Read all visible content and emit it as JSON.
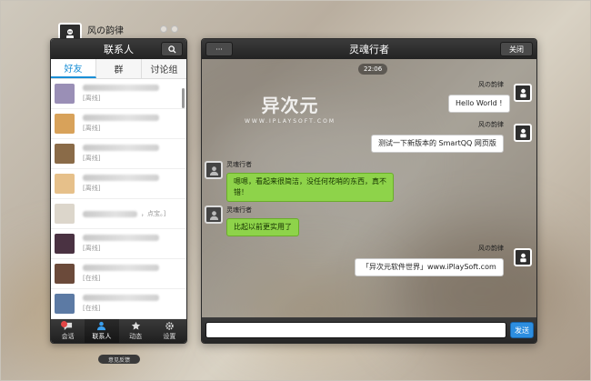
{
  "user": {
    "name": "风の韵律"
  },
  "contacts": {
    "title": "联系人",
    "tabs": [
      "好友",
      "群",
      "讨论组"
    ],
    "items": [
      {
        "status": "[离线]",
        "color": "#9a8fb6"
      },
      {
        "status": "[离线]",
        "color": "#d8a25a"
      },
      {
        "status": "[离线]",
        "color": "#8a6b48"
      },
      {
        "status": "[离线]",
        "color": "#e6c08a"
      },
      {
        "status": "",
        "color": "#dcd6cb"
      },
      {
        "status": "[离线]",
        "color": "#4a3242"
      },
      {
        "status": "[在线]",
        "color": "#6b4a3a"
      },
      {
        "status": "[在线]",
        "color": "#5c7aa4"
      }
    ],
    "item_note": "，点宝。]"
  },
  "nav": {
    "items": [
      {
        "label": "会话",
        "icon": "chat-bubble-icon"
      },
      {
        "label": "联系人",
        "icon": "person-icon"
      },
      {
        "label": "动态",
        "icon": "star-icon"
      },
      {
        "label": "设置",
        "icon": "gear-icon"
      }
    ]
  },
  "feedback_label": "意见反馈",
  "chat": {
    "title": "灵魂行者",
    "more_label": "···",
    "close_label": "关闭",
    "time": "22:06",
    "watermark": {
      "main": "异次元",
      "sub": "WWW.IPLAYSOFT.COM"
    },
    "send_label": "发送",
    "messages": [
      {
        "side": "out",
        "sender": "风の韵律",
        "text": "Hello World !"
      },
      {
        "side": "out",
        "sender": "风の韵律",
        "text": "测试一下新版本的 SmartQQ 网页版"
      },
      {
        "side": "in",
        "sender": "灵魂行者",
        "line1": "嗯嗯，看起来很简洁，没任何花哨的东西，真不",
        "line2": "错！"
      },
      {
        "side": "in",
        "sender": "灵魂行者",
        "text": "比起以前更实用了"
      },
      {
        "side": "out",
        "sender": "风の韵律",
        "text": "「异次元软件世界」www.iPlaySoft.com"
      }
    ]
  },
  "colors": {
    "accent": "#1a8fd6",
    "send": "#2d8ee0",
    "bubble_in": "#8ed34a"
  }
}
